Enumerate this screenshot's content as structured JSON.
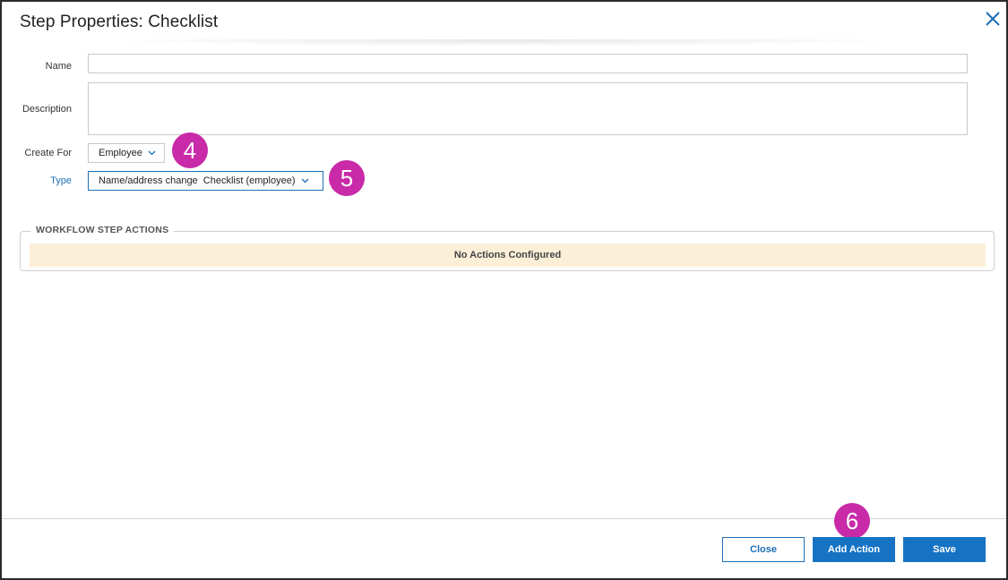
{
  "dialog": {
    "title": "Step Properties: Checklist"
  },
  "form": {
    "name_label": "Name",
    "name_value": "",
    "description_label": "Description",
    "description_value": "",
    "create_for_label": "Create For",
    "create_for_value": "Employee",
    "type_label": "Type",
    "type_value": "Name/address change  Checklist (employee)"
  },
  "callouts": {
    "create_for": "4",
    "type": "5",
    "add_action": "6"
  },
  "actions_section": {
    "legend": "WORKFLOW STEP ACTIONS",
    "empty_text": "No Actions Configured"
  },
  "footer": {
    "close_label": "Close",
    "add_action_label": "Add Action",
    "save_label": "Save"
  },
  "colors": {
    "accent": "#1673c4",
    "callout": "#c82aa8",
    "empty_banner": "#fcefd8"
  },
  "icons": {
    "close": "close-icon",
    "dropdown": "chevron-down-icon"
  }
}
